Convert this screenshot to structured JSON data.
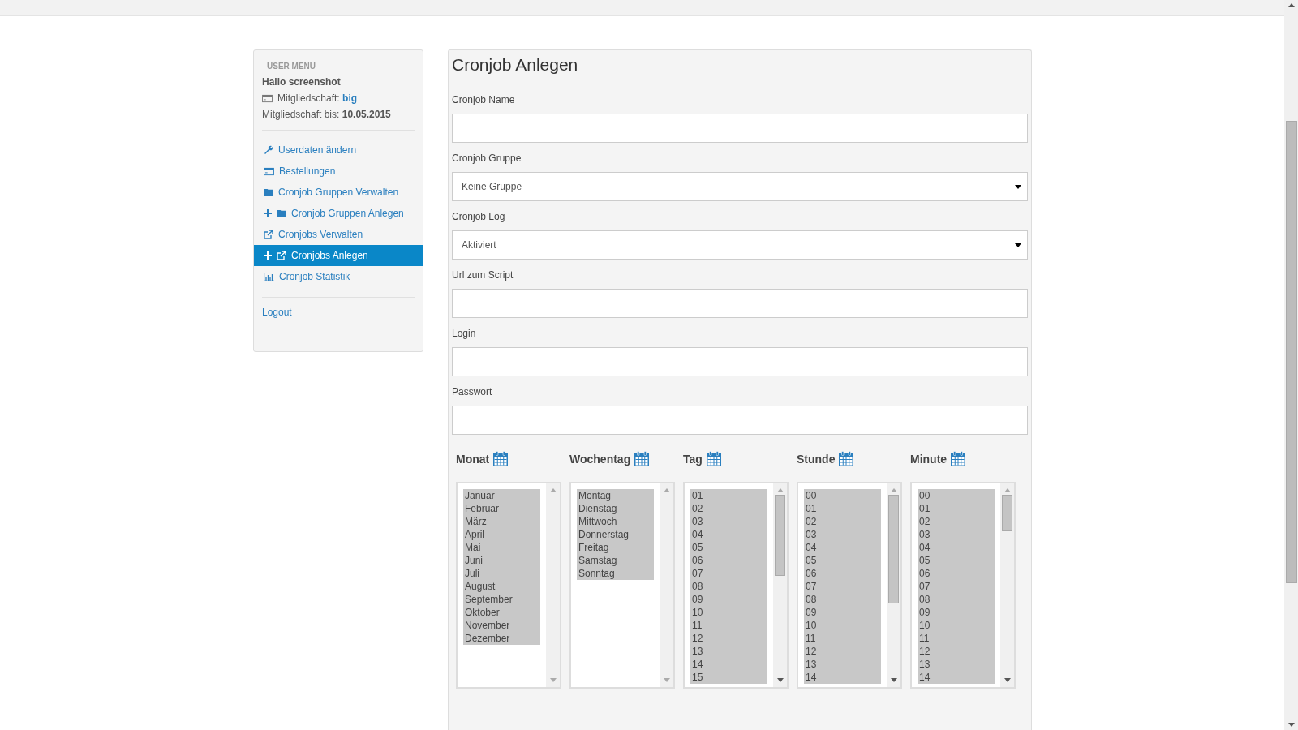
{
  "sidebar": {
    "heading": "USER MENU",
    "greeting": "Hallo screenshot",
    "membership": {
      "label": "Mitgliedschaft:",
      "value": "big"
    },
    "until": {
      "label": "Mitgliedschaft bis:",
      "value": "10.05.2015"
    },
    "items": [
      {
        "label": "Userdaten ändern",
        "kind": "wrench",
        "plus": false,
        "selected": false
      },
      {
        "label": "Bestellungen",
        "kind": "card",
        "plus": false,
        "selected": false
      },
      {
        "label": "Cronjob Gruppen Verwalten",
        "kind": "folder",
        "plus": false,
        "selected": false
      },
      {
        "label": "Cronjob Gruppen Anlegen",
        "kind": "folder",
        "plus": true,
        "selected": false
      },
      {
        "label": "Cronjobs Verwalten",
        "kind": "link",
        "plus": false,
        "selected": false
      },
      {
        "label": "Cronjobs Anlegen",
        "kind": "link",
        "plus": true,
        "selected": true
      },
      {
        "label": "Cronjob Statistik",
        "kind": "chart",
        "plus": false,
        "selected": false
      }
    ],
    "logout": "Logout"
  },
  "form": {
    "title": "Cronjob Anlegen",
    "fields": [
      {
        "kind": "text",
        "label": "Cronjob Name"
      },
      {
        "kind": "select",
        "label": "Cronjob Gruppe",
        "value": "Keine Gruppe"
      },
      {
        "kind": "select",
        "label": "Cronjob Log",
        "value": "Aktiviert"
      },
      {
        "kind": "text",
        "label": "Url zum Script"
      },
      {
        "kind": "text",
        "label": "Login"
      },
      {
        "kind": "text",
        "label": "Passwort"
      }
    ],
    "schedule": [
      {
        "label": "Monat",
        "options": [
          {
            "label": "Januar",
            "selected": true
          },
          {
            "label": "Februar",
            "selected": true
          },
          {
            "label": "März",
            "selected": true
          },
          {
            "label": "April",
            "selected": true
          },
          {
            "label": "Mai",
            "selected": true
          },
          {
            "label": "Juni",
            "selected": true
          },
          {
            "label": "Juli",
            "selected": true
          },
          {
            "label": "August",
            "selected": true
          },
          {
            "label": "September",
            "selected": true
          },
          {
            "label": "Oktober",
            "selected": true
          },
          {
            "label": "November",
            "selected": true
          },
          {
            "label": "Dezember",
            "selected": true
          }
        ]
      },
      {
        "label": "Wochentag",
        "options": [
          {
            "label": "Montag",
            "selected": true
          },
          {
            "label": "Dienstag",
            "selected": true
          },
          {
            "label": "Mittwoch",
            "selected": true
          },
          {
            "label": "Donnerstag",
            "selected": true
          },
          {
            "label": "Freitag",
            "selected": true
          },
          {
            "label": "Samstag",
            "selected": true
          },
          {
            "label": "Sonntag",
            "selected": true
          }
        ]
      },
      {
        "label": "Tag",
        "options": [
          {
            "label": "01",
            "selected": true
          },
          {
            "label": "02",
            "selected": true
          },
          {
            "label": "03",
            "selected": true
          },
          {
            "label": "04",
            "selected": true
          },
          {
            "label": "05",
            "selected": true
          },
          {
            "label": "06",
            "selected": true
          },
          {
            "label": "07",
            "selected": true
          },
          {
            "label": "08",
            "selected": true
          },
          {
            "label": "09",
            "selected": true
          },
          {
            "label": "10",
            "selected": true
          },
          {
            "label": "11",
            "selected": true
          },
          {
            "label": "12",
            "selected": true
          },
          {
            "label": "13",
            "selected": true
          },
          {
            "label": "14",
            "selected": true
          },
          {
            "label": "15",
            "selected": true
          }
        ]
      },
      {
        "label": "Stunde",
        "options": [
          {
            "label": "00",
            "selected": true
          },
          {
            "label": "01",
            "selected": true
          },
          {
            "label": "02",
            "selected": true
          },
          {
            "label": "03",
            "selected": true
          },
          {
            "label": "04",
            "selected": true
          },
          {
            "label": "05",
            "selected": true
          },
          {
            "label": "06",
            "selected": true
          },
          {
            "label": "07",
            "selected": true
          },
          {
            "label": "08",
            "selected": true
          },
          {
            "label": "09",
            "selected": true
          },
          {
            "label": "10",
            "selected": true
          },
          {
            "label": "11",
            "selected": true
          },
          {
            "label": "12",
            "selected": true
          },
          {
            "label": "13",
            "selected": true
          },
          {
            "label": "14",
            "selected": true
          }
        ]
      },
      {
        "label": "Minute",
        "options": [
          {
            "label": "00",
            "selected": true
          },
          {
            "label": "01",
            "selected": true
          },
          {
            "label": "02",
            "selected": true
          },
          {
            "label": "03",
            "selected": true
          },
          {
            "label": "04",
            "selected": true
          },
          {
            "label": "05",
            "selected": true
          },
          {
            "label": "06",
            "selected": true
          },
          {
            "label": "07",
            "selected": true
          },
          {
            "label": "08",
            "selected": true
          },
          {
            "label": "09",
            "selected": true
          },
          {
            "label": "10",
            "selected": true
          },
          {
            "label": "11",
            "selected": true
          },
          {
            "label": "12",
            "selected": true
          },
          {
            "label": "13",
            "selected": true
          },
          {
            "label": "14",
            "selected": true
          }
        ]
      }
    ]
  }
}
